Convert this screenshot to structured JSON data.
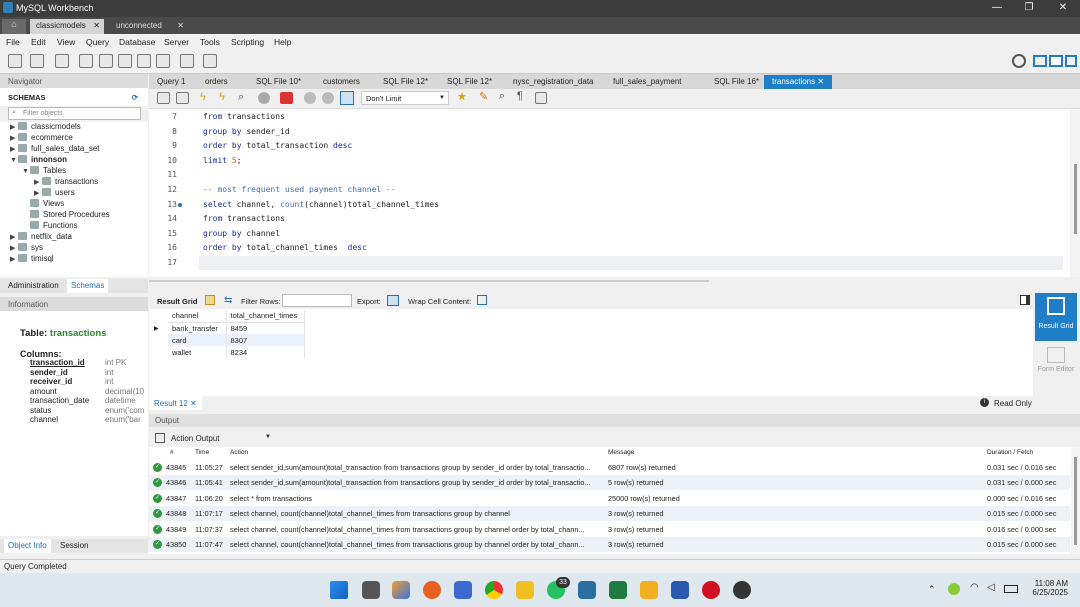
{
  "app": {
    "title": "MySQL Workbench"
  },
  "connection_tabs": [
    "classicmodels",
    "unconnected"
  ],
  "menu": [
    "File",
    "Edit",
    "View",
    "Query",
    "Database",
    "Server",
    "Tools",
    "Scripting",
    "Help"
  ],
  "navigator": {
    "header": "Navigator",
    "schemas_label": "SCHEMAS",
    "filter_placeholder": "Filter objects",
    "tree": [
      {
        "label": "classicmodels",
        "depth": 0,
        "arrow": "▶"
      },
      {
        "label": "ecommerce",
        "depth": 0,
        "arrow": "▶"
      },
      {
        "label": "full_sales_data_set",
        "depth": 0,
        "arrow": "▶"
      },
      {
        "label": "innonson",
        "depth": 0,
        "arrow": "▼",
        "bold": true
      },
      {
        "label": "Tables",
        "depth": 1,
        "arrow": "▼"
      },
      {
        "label": "transactions",
        "depth": 2,
        "arrow": "▶"
      },
      {
        "label": "users",
        "depth": 2,
        "arrow": "▶"
      },
      {
        "label": "Views",
        "depth": 1,
        "arrow": ""
      },
      {
        "label": "Stored Procedures",
        "depth": 1,
        "arrow": ""
      },
      {
        "label": "Functions",
        "depth": 1,
        "arrow": ""
      },
      {
        "label": "netflix_data",
        "depth": 0,
        "arrow": "▶"
      },
      {
        "label": "sys",
        "depth": 0,
        "arrow": "▶"
      },
      {
        "label": "timisql",
        "depth": 0,
        "arrow": "▶"
      }
    ],
    "tabs": [
      "Administration",
      "Schemas"
    ]
  },
  "info": {
    "header": "Information",
    "table_prefix": "Table:",
    "table_name": "transactions",
    "columns_label": "Columns:",
    "columns": [
      {
        "name": "transaction_id",
        "type": "int PK",
        "bold": true,
        "underline": true
      },
      {
        "name": "sender_id",
        "type": "int",
        "bold": true
      },
      {
        "name": "receiver_id",
        "type": "int",
        "bold": true
      },
      {
        "name": "amount",
        "type": "decimal(10"
      },
      {
        "name": "transaction_date",
        "type": "datetime"
      },
      {
        "name": "status",
        "type": "enum('com"
      },
      {
        "name": "channel",
        "type": "enum('bar"
      }
    ],
    "bottom_tabs": [
      "Object Info",
      "Session"
    ]
  },
  "query_tabs": [
    "Query 1",
    "orders",
    "SQL File 10*",
    "customers",
    "SQL File 12*",
    "SQL File 12*",
    "nysc_registration_data",
    "full_sales_payment",
    "SQL File 16*",
    "transactions"
  ],
  "editor_toolbar": {
    "limit": "Don't Limit"
  },
  "editor": {
    "lines": [
      {
        "n": "7",
        "text": "from transactions"
      },
      {
        "n": "8",
        "text": "group by sender_id"
      },
      {
        "n": "9",
        "text": "order by total_transaction desc"
      },
      {
        "n": "10",
        "text": "limit 5;"
      },
      {
        "n": "11",
        "text": ""
      },
      {
        "n": "12",
        "text": "-- most frequent used payment channel --"
      },
      {
        "n": "13",
        "text": "select channel, count(channel)total_channel_times"
      },
      {
        "n": "14",
        "text": "from transactions"
      },
      {
        "n": "15",
        "text": "group by channel"
      },
      {
        "n": "16",
        "text": "order by total_channel_times  desc"
      },
      {
        "n": "17",
        "text": ""
      }
    ]
  },
  "result": {
    "grid_label": "Result Grid",
    "filter_label": "Filter Rows:",
    "export_label": "Export:",
    "wrap_label": "Wrap Cell Content:",
    "columns": [
      "channel",
      "total_channel_times"
    ],
    "rows": [
      [
        "bank_transfer",
        "8459"
      ],
      [
        "card",
        "8307"
      ],
      [
        "wallet",
        "8234"
      ]
    ],
    "side": [
      "Result Grid",
      "Form Editor"
    ],
    "tab": "Result 12",
    "read_only": "Read Only"
  },
  "output": {
    "header": "Output",
    "mode": "Action Output",
    "columns": [
      "#",
      "Time",
      "Action",
      "Message",
      "Duration / Fetch"
    ],
    "rows": [
      [
        "43845",
        "11:05:27",
        "select sender_id,sum(amount)total_transaction  from transactions  group by sender_id  order by total_transactio...",
        "6807 row(s) returned",
        "0.031 sec / 0.016 sec"
      ],
      [
        "43846",
        "11:05:41",
        "select sender_id,sum(amount)total_transaction  from transactions  group by sender_id  order by total_transactio...",
        "5 row(s) returned",
        "0.031 sec / 0.000 sec"
      ],
      [
        "43847",
        "11:06:20",
        "select * from transactions",
        "25000 row(s) returned",
        "0.000 sec / 0.016 sec"
      ],
      [
        "43848",
        "11:07:17",
        "select channel, count(channel)total_channel_times  from transactions  group by channel",
        "3 row(s) returned",
        "0.015 sec / 0.000 sec"
      ],
      [
        "43849",
        "11:07:37",
        "select channel, count(channel)total_channel_times  from transactions  group by channel  order by total_chann...",
        "3 row(s) returned",
        "0.016 sec / 0.000 sec"
      ],
      [
        "43850",
        "11:07:47",
        "select channel, count(channel)total_channel_times  from transactions  group by channel  order by total_chann...",
        "3 row(s) returned",
        "0.015 sec / 0.000 sec"
      ]
    ]
  },
  "status": "Query Completed",
  "taskbar": {
    "time": "11:08 AM",
    "date": "6/25/2025",
    "badge": "33"
  }
}
